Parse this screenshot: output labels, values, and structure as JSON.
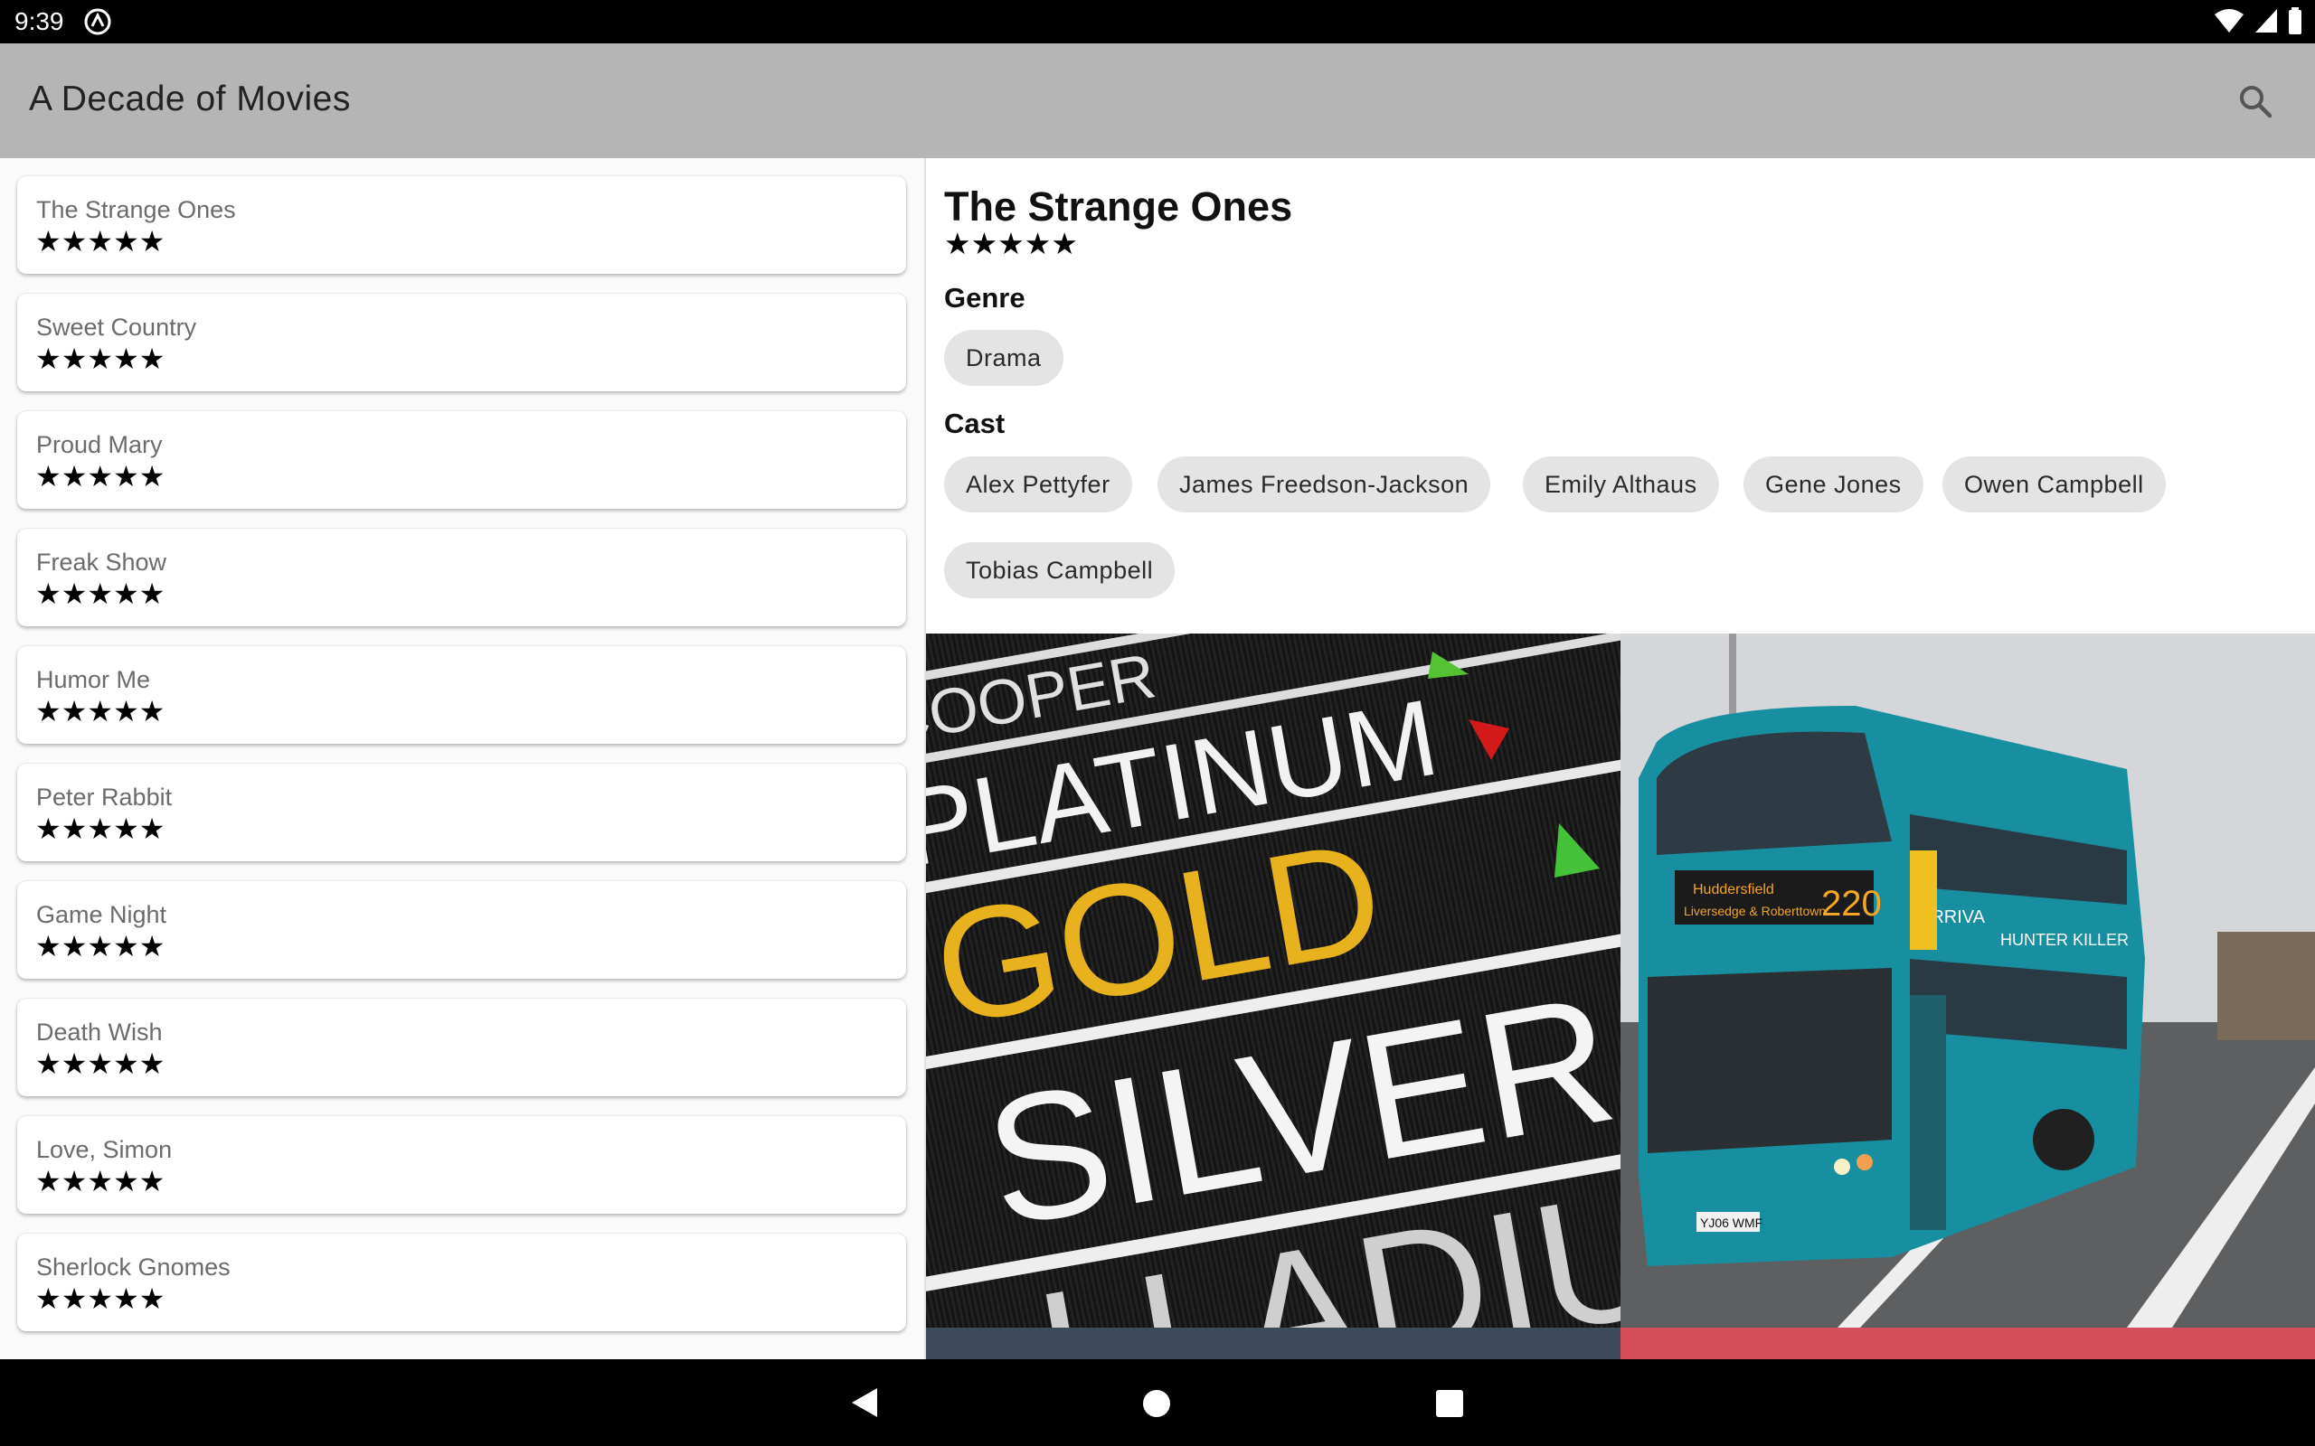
{
  "status_bar": {
    "time": "9:39"
  },
  "app_bar": {
    "title": "A Decade of Movies",
    "search_icon": "search-icon"
  },
  "movies": [
    {
      "title": "The Strange Ones",
      "stars": "★★★★★"
    },
    {
      "title": "Sweet Country",
      "stars": "★★★★★"
    },
    {
      "title": "Proud Mary",
      "stars": "★★★★★"
    },
    {
      "title": "Freak Show",
      "stars": "★★★★★"
    },
    {
      "title": "Humor Me",
      "stars": "★★★★★"
    },
    {
      "title": "Peter Rabbit",
      "stars": "★★★★★"
    },
    {
      "title": "Game Night",
      "stars": "★★★★★"
    },
    {
      "title": "Death Wish",
      "stars": "★★★★★"
    },
    {
      "title": "Love, Simon",
      "stars": "★★★★★"
    },
    {
      "title": "Sherlock Gnomes",
      "stars": "★★★★★"
    }
  ],
  "detail": {
    "title": "The Strange Ones",
    "stars": "★★★★★",
    "genre_label": "Genre",
    "genres": [
      "Drama"
    ],
    "cast_label": "Cast",
    "cast": [
      "Alex Pettyfer",
      "James Freedson-Jackson",
      "Emily Althaus",
      "Gene Jones",
      "Owen Campbell",
      "Tobias Campbell"
    ],
    "poster1": {
      "lines": [
        "COOPER",
        "PLATINUM",
        "GOLD",
        "SILVER",
        "LLADIU"
      ]
    },
    "poster2": {
      "destination": "Huddersfield",
      "route_via": "Liversedge & Roberttown",
      "route_number": "220",
      "operator": "ARRIVA",
      "banner": "HUNTER KILLER",
      "plate": "YJ06 WMF"
    }
  },
  "colors": {
    "app_bar": "#b5b5b5",
    "chip": "#e4e4e4",
    "status_bar": "#000000"
  },
  "nav": {
    "back_icon": "back-triangle-icon",
    "home_icon": "home-circle-icon",
    "recents_icon": "recents-square-icon"
  }
}
